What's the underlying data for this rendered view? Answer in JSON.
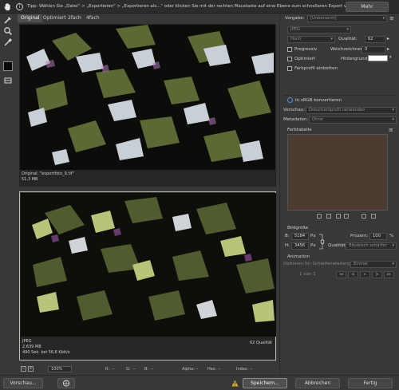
{
  "tipbar": {
    "tip": "Tipp: Wählen Sie „Datei“ > „Exportieren“ > „Exportieren als...“ oder klicken Sie mit der rechten Maustaste auf eine Ebene zum schnelleren Export von Elementen",
    "more_label": "Mehr",
    "info_glyph": "i"
  },
  "tabs": [
    "Original",
    "Optimiert",
    "2fach",
    "4fach"
  ],
  "original_pane": {
    "line1": "Original: \"exportfoto_9.tif\"",
    "line2": "51,3 MB"
  },
  "optimized_pane": {
    "line1": "JPEG",
    "line2": "2,639 MB",
    "line3": "490 Sek. bei 56,6 Kbit/s",
    "quality": "62 Qualität"
  },
  "status": {
    "zoom": "100%",
    "r": "R:",
    "g": "G:",
    "b": "B:",
    "alpha": "Alpha:",
    "hex": "Hex:",
    "index": "Index:",
    "r_value": "--",
    "g_value": "--",
    "b_value": "--",
    "alpha_value": "--",
    "hex_value": "--",
    "index_value": "--"
  },
  "footer": {
    "preview": "Vorschau...",
    "save": "Speichern...",
    "cancel": "Abbrechen",
    "done": "Fertig"
  },
  "settings": {
    "preset_label": "Vorgabe:",
    "preset_value": "[Unbenannt]",
    "format_value": "JPEG",
    "quality_level": "Hoch",
    "quality_label": "Qualität:",
    "quality_value": "62",
    "progressive_label": "Progressiv",
    "blur_label": "Weichzeichnen:",
    "blur_value": "0",
    "optimized_label": "Optimiert",
    "matte_label": "Hintergrund:",
    "embed_profile_label": "Farbprofil einbetten",
    "convert_srgb_label": "In sRGB konvertieren",
    "preview_label": "Vorschau:",
    "preview_value": "Dokumentprofil verwenden",
    "metadata_label": "Metadaten:",
    "metadata_value": "Ohne",
    "color_table_label": "Farbtabelle",
    "image_size_label": "Bildgröße",
    "width_label": "B:",
    "width_value": "5184",
    "height_label": "H:",
    "height_value": "3456",
    "unit_px": "Px",
    "percent_label": "Prozent:",
    "percent_value": "100",
    "percent_unit": "%",
    "resample_label": "Qualität:",
    "resample_value": "Bikubisch schärfer",
    "animation_label": "Animation",
    "loop_label": "Optionen für Schleifenwiedergabe:",
    "loop_value": "Einmal",
    "frame_counter": "1 von 1"
  },
  "colors": {
    "accent": "#4a90d9",
    "panel": "#383838",
    "color_table_bg": "#4b3b31"
  }
}
